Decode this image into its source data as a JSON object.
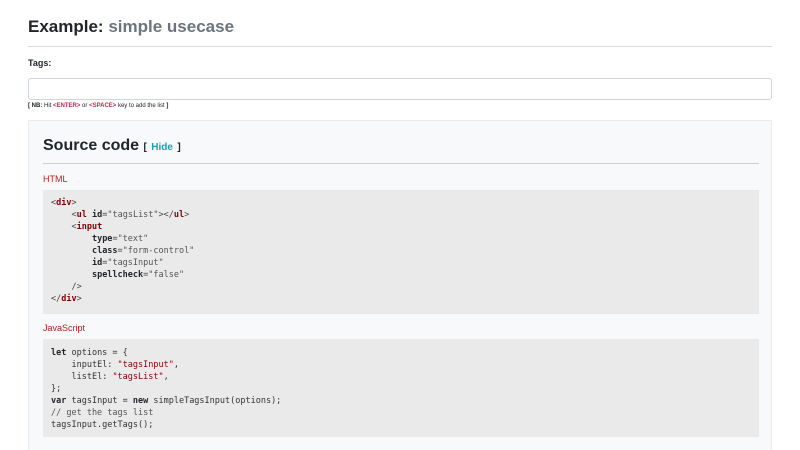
{
  "header": {
    "title_prefix": "Example:",
    "title_suffix": "simple usecase"
  },
  "tags_field": {
    "label": "Tags:",
    "value": "",
    "placeholder": ""
  },
  "hint": {
    "open": "[",
    "nb": "NB:",
    "text_before": "Hit",
    "key_enter": "<ENTER>",
    "or": "or",
    "key_space": "<SPACE>",
    "text_after": "key to add the list",
    "close": "]"
  },
  "source": {
    "heading": "Source code",
    "bracket_open": "[",
    "hide_label": "Hide",
    "bracket_close": "]",
    "html_label": "HTML",
    "js_label": "JavaScript",
    "html_code": {
      "l1_tag": "div",
      "l2_tag": "ul",
      "l2_attr": "id",
      "l2_val": "\"tagsList\"",
      "l2_close": "ul",
      "l3_tag": "input",
      "l4_attr": "type",
      "l4_val": "\"text\"",
      "l5_attr": "class",
      "l5_val": "\"form-control\"",
      "l6_attr": "id",
      "l6_val": "\"tagsInput\"",
      "l7_attr": "spellcheck",
      "l7_val": "\"false\"",
      "l8": "/>",
      "l9_tag": "div"
    },
    "js_code": {
      "l1_kw": "let",
      "l1_rest": " options = {",
      "l2_key": "inputEl: ",
      "l2_val": "\"tagsInput\"",
      "l2_end": ",",
      "l3_key": "listEl: ",
      "l3_val": "\"tagsList\"",
      "l3_end": ",",
      "l4": "};",
      "l5_kw": "var",
      "l5_mid": " tagsInput = ",
      "l5_kw2": "new",
      "l5_rest": " simpleTagsInput(options);",
      "l6": "// get the tags list",
      "l7": "tagsInput.getTags();"
    }
  }
}
